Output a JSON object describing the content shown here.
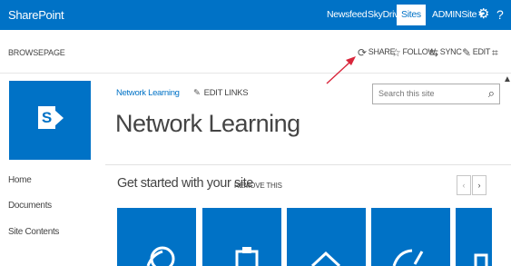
{
  "topbar": {
    "brand": "SharePoint",
    "links": [
      "Newsfeed",
      "SkyDrive",
      "Sites"
    ],
    "active": "Sites",
    "user": "ADMINSite ▾",
    "settings_icon": "gear-icon",
    "help": "?"
  },
  "ribbon": {
    "tabs": [
      "BROWSE",
      "PAGE"
    ],
    "actions": [
      {
        "label": "SHARE",
        "icon": "share-icon"
      },
      {
        "label": "FOLLOW",
        "icon": "star-icon"
      },
      {
        "label": "SYNC",
        "icon": "sync-icon"
      },
      {
        "label": "EDIT",
        "icon": "pencil-icon"
      }
    ],
    "focus_icon": "fullscreen-icon"
  },
  "site": {
    "breadcrumb": "Network Learning",
    "edit_links": "EDIT LINKS",
    "title": "Network Learning",
    "logo_letter": "S"
  },
  "search": {
    "placeholder": "Search this site",
    "icon": "search-icon"
  },
  "quicklaunch": [
    "Home",
    "Documents",
    "Site Contents"
  ],
  "getting_started": {
    "title": "Get started with your site",
    "remove": "REMOVE THIS",
    "prev": "‹",
    "next": "›"
  },
  "colors": {
    "accent": "#0072c6",
    "annotation_arrow": "#d9263b"
  }
}
